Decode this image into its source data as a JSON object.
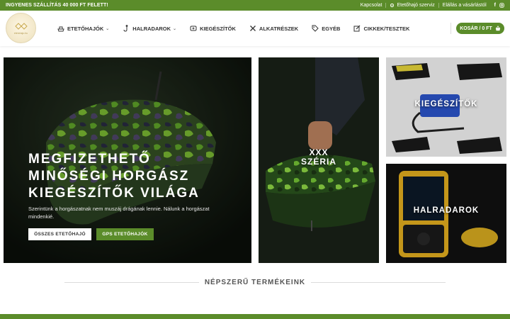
{
  "topbar": {
    "promo": "INGYENES SZÁLLÍTÁS 40 000 FT FELETT!",
    "links": [
      "Kapcsolat",
      "Etetőhajó szerviz",
      "Elállás a vásárlástól"
    ],
    "social": [
      "f",
      "ig"
    ]
  },
  "header": {
    "logo_text": "etetohajo.hu",
    "nav": [
      {
        "label": "ETETŐHAJÓK",
        "icon": "boat-icon",
        "dropdown": true
      },
      {
        "label": "HALRADAROK",
        "icon": "hook-icon",
        "dropdown": true
      },
      {
        "label": "KIEGÉSZÍTŐK",
        "icon": "accessories-icon",
        "dropdown": false
      },
      {
        "label": "ALKATRÉSZEK",
        "icon": "tools-icon",
        "dropdown": false
      },
      {
        "label": "EGYÉB",
        "icon": "tag-icon",
        "dropdown": false
      },
      {
        "label": "CIKKEK/TESZTEK",
        "icon": "edit-icon",
        "dropdown": false
      }
    ],
    "cart_label": "KOSÁR / 0 FT"
  },
  "hero": {
    "title_lines": [
      "MEGFIZETHETŐ",
      "MINŐSÉGI HORGÁSZ",
      "KIEGÉSZÍTŐK VILÁGA"
    ],
    "subtitle": "Szerintünk a horgászatnak nem muszáj drágának lennie. Nálunk a horgászat mindenkié.",
    "btn_all": "ÖSSZES ETETŐHAJÓ",
    "btn_gps": "GPS ETETŐHAJÓK"
  },
  "tiles": {
    "xxx": [
      "XXX",
      "SZÉRIA"
    ],
    "kieg": "KIEGÉSZÍTŐK",
    "halr": "HALRADAROK"
  },
  "section_title": "NÉPSZERŰ TERMÉKEINK",
  "colors": {
    "accent": "#5b8c2a"
  }
}
